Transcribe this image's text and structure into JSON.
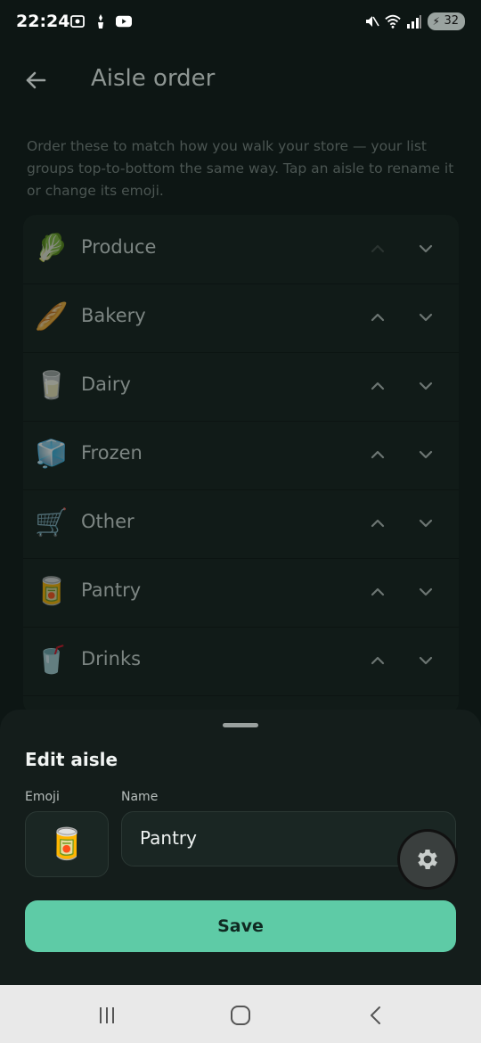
{
  "status": {
    "time": "22:24",
    "battery": "32"
  },
  "header": {
    "title": "Aisle order"
  },
  "intro": "Order these to match how you walk your store — your list groups top-to-bottom the same way. Tap an aisle to rename it or change its emoji.",
  "aisles": [
    {
      "emoji": "🥬",
      "name": "Produce"
    },
    {
      "emoji": "🥖",
      "name": "Bakery"
    },
    {
      "emoji": "🥛",
      "name": "Dairy"
    },
    {
      "emoji": "🧊",
      "name": "Frozen"
    },
    {
      "emoji": "🛒",
      "name": "Other"
    },
    {
      "emoji": "🥫",
      "name": "Pantry"
    },
    {
      "emoji": "🥤",
      "name": "Drinks"
    }
  ],
  "sheet": {
    "title": "Edit aisle",
    "emoji_label": "Emoji",
    "name_label": "Name",
    "emoji_value": "🥫",
    "name_value": "Pantry",
    "save_label": "Save"
  },
  "colors": {
    "background": "#0d1614",
    "accent": "#5ecba6",
    "sheet": "#141d1b"
  },
  "icons": [
    "back-arrow-icon",
    "chevron-up-icon",
    "chevron-down-icon",
    "gear-icon",
    "recent-apps-icon",
    "home-icon",
    "nav-back-icon"
  ]
}
